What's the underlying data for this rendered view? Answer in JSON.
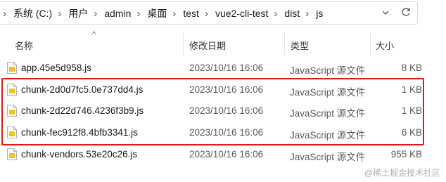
{
  "address_bar": {
    "breadcrumbs": [
      "系统 (C:)",
      "用户",
      "admin",
      "桌面",
      "test",
      "vue2-cli-test",
      "dist",
      "js"
    ],
    "separator": "›",
    "dropdown_icon": "chevron-down-icon",
    "refresh_icon": "refresh-icon"
  },
  "columns": {
    "name": "名称",
    "modified": "修改日期",
    "type": "类型",
    "size": "大小",
    "sort_indicator": "^"
  },
  "files": [
    {
      "name": "app.45e5d958.js",
      "modified": "2023/10/16 16:06",
      "type": "JavaScript 源文件",
      "size": "8 KB"
    },
    {
      "name": "chunk-2d0d7fc5.0e737dd4.js",
      "modified": "2023/10/16 16:06",
      "type": "JavaScript 源文件",
      "size": "1 KB"
    },
    {
      "name": "chunk-2d22d746.4236f3b9.js",
      "modified": "2023/10/16 16:06",
      "type": "JavaScript 源文件",
      "size": "1 KB"
    },
    {
      "name": "chunk-fec912f8.4bfb3341.js",
      "modified": "2023/10/16 16:06",
      "type": "JavaScript 源文件",
      "size": "6 KB"
    },
    {
      "name": "chunk-vendors.53e20c26.js",
      "modified": "2023/10/16 16:06",
      "type": "JavaScript 源文件",
      "size": "955 KB"
    }
  ],
  "highlight_color": "#e0191b",
  "watermark": "@稀土掘金技术社区"
}
